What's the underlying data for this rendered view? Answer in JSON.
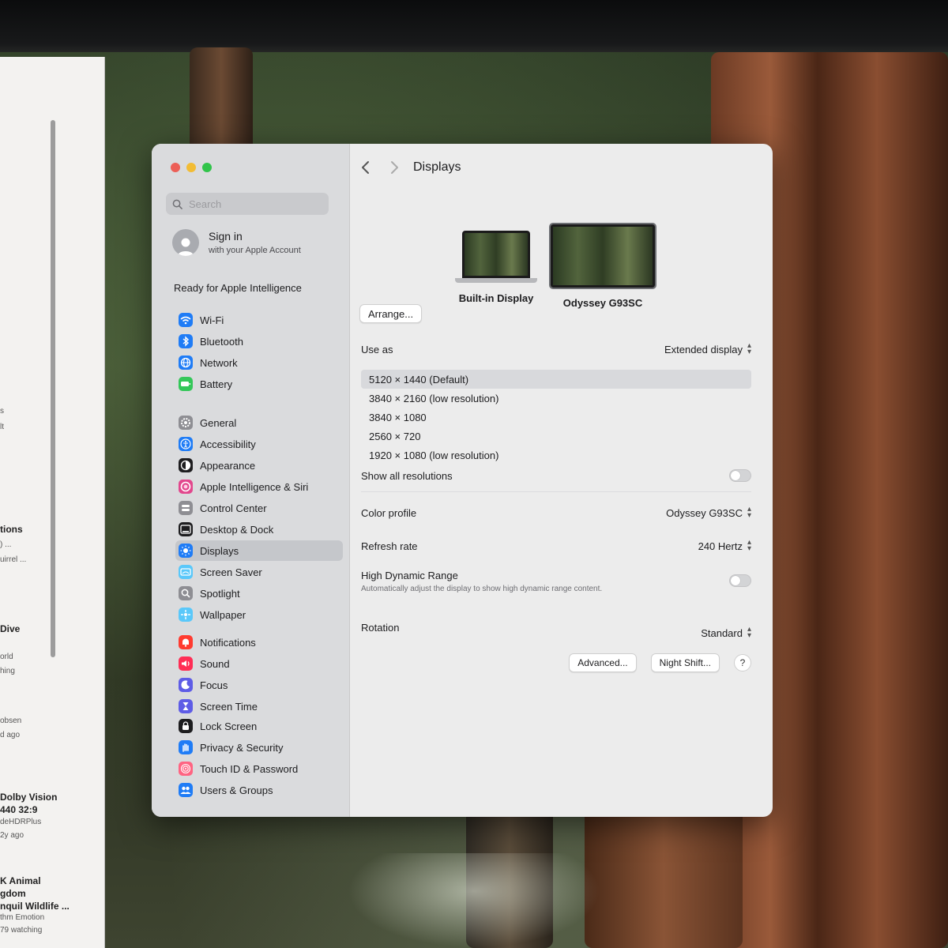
{
  "background_window": {
    "lines": [
      "s",
      "lt",
      "tions",
      ") ...",
      "uirrel ...",
      "Dive",
      "orld",
      "hing",
      "obsen",
      "d ago",
      "Dolby Vision",
      "440 32:9",
      "deHDRPlus",
      "2y ago",
      "K Animal",
      "gdom",
      "nquil Wildlife ...",
      "thm Emotion",
      "79 watching"
    ]
  },
  "sidebar": {
    "search_placeholder": "Search",
    "account_title": "Sign in",
    "account_subtitle": "with your Apple Account",
    "ai_ready": "Ready for Apple Intelligence",
    "groups": [
      [
        {
          "label": "Wi-Fi",
          "icon": "wifi-icon",
          "color": "#1f7cf6"
        },
        {
          "label": "Bluetooth",
          "icon": "bluetooth-icon",
          "color": "#1f7cf6"
        },
        {
          "label": "Network",
          "icon": "globe-icon",
          "color": "#1f7cf6"
        },
        {
          "label": "Battery",
          "icon": "battery-icon",
          "color": "#34c759"
        }
      ],
      [
        {
          "label": "General",
          "icon": "gear-icon",
          "color": "#8e8e93"
        },
        {
          "label": "Accessibility",
          "icon": "accessibility-icon",
          "color": "#1f7cf6"
        },
        {
          "label": "Appearance",
          "icon": "appearance-icon",
          "color": "#1d1d1f"
        },
        {
          "label": "Apple Intelligence & Siri",
          "icon": "siri-icon",
          "color": "#e2478d"
        },
        {
          "label": "Control Center",
          "icon": "control-center-icon",
          "color": "#8e8e93"
        },
        {
          "label": "Desktop & Dock",
          "icon": "dock-icon",
          "color": "#1d1d1f"
        },
        {
          "label": "Displays",
          "icon": "sun-icon",
          "color": "#1f7cf6",
          "selected": true
        },
        {
          "label": "Screen Saver",
          "icon": "screen-saver-icon",
          "color": "#5ac8fa"
        },
        {
          "label": "Spotlight",
          "icon": "spotlight-icon",
          "color": "#8e8e93"
        },
        {
          "label": "Wallpaper",
          "icon": "wallpaper-icon",
          "color": "#5ac8fa"
        }
      ],
      [
        {
          "label": "Notifications",
          "icon": "bell-icon",
          "color": "#ff3b30"
        },
        {
          "label": "Sound",
          "icon": "speaker-icon",
          "color": "#ff2d55"
        },
        {
          "label": "Focus",
          "icon": "moon-icon",
          "color": "#5e5ce6"
        },
        {
          "label": "Screen Time",
          "icon": "hourglass-icon",
          "color": "#5e5ce6"
        }
      ],
      [
        {
          "label": "Lock Screen",
          "icon": "lock-icon",
          "color": "#1d1d1f"
        },
        {
          "label": "Privacy & Security",
          "icon": "hand-icon",
          "color": "#1f7cf6"
        },
        {
          "label": "Touch ID & Password",
          "icon": "fingerprint-icon",
          "color": "#ff6482"
        },
        {
          "label": "Users & Groups",
          "icon": "users-icon",
          "color": "#1f7cf6"
        }
      ]
    ]
  },
  "main": {
    "title": "Displays",
    "arrange_label": "Arrange...",
    "displays": [
      "Built-in Display",
      "Odyssey G93SC"
    ],
    "use_as_label": "Use as",
    "use_as_value": "Extended display",
    "resolutions": [
      {
        "label": "5120 × 1440 (Default)",
        "selected": true
      },
      {
        "label": "3840 × 2160 (low resolution)"
      },
      {
        "label": "3840 × 1080"
      },
      {
        "label": "2560 × 720"
      },
      {
        "label": "1920 × 1080 (low resolution)"
      }
    ],
    "show_all_label": "Show all resolutions",
    "color_profile_label": "Color profile",
    "color_profile_value": "Odyssey G93SC",
    "refresh_label": "Refresh rate",
    "refresh_value": "240 Hertz",
    "hdr_label": "High Dynamic Range",
    "hdr_desc": "Automatically adjust the display to show high dynamic range content.",
    "rotation_label": "Rotation",
    "rotation_value": "Standard",
    "advanced_label": "Advanced...",
    "night_shift_label": "Night Shift...",
    "help_label": "?"
  }
}
